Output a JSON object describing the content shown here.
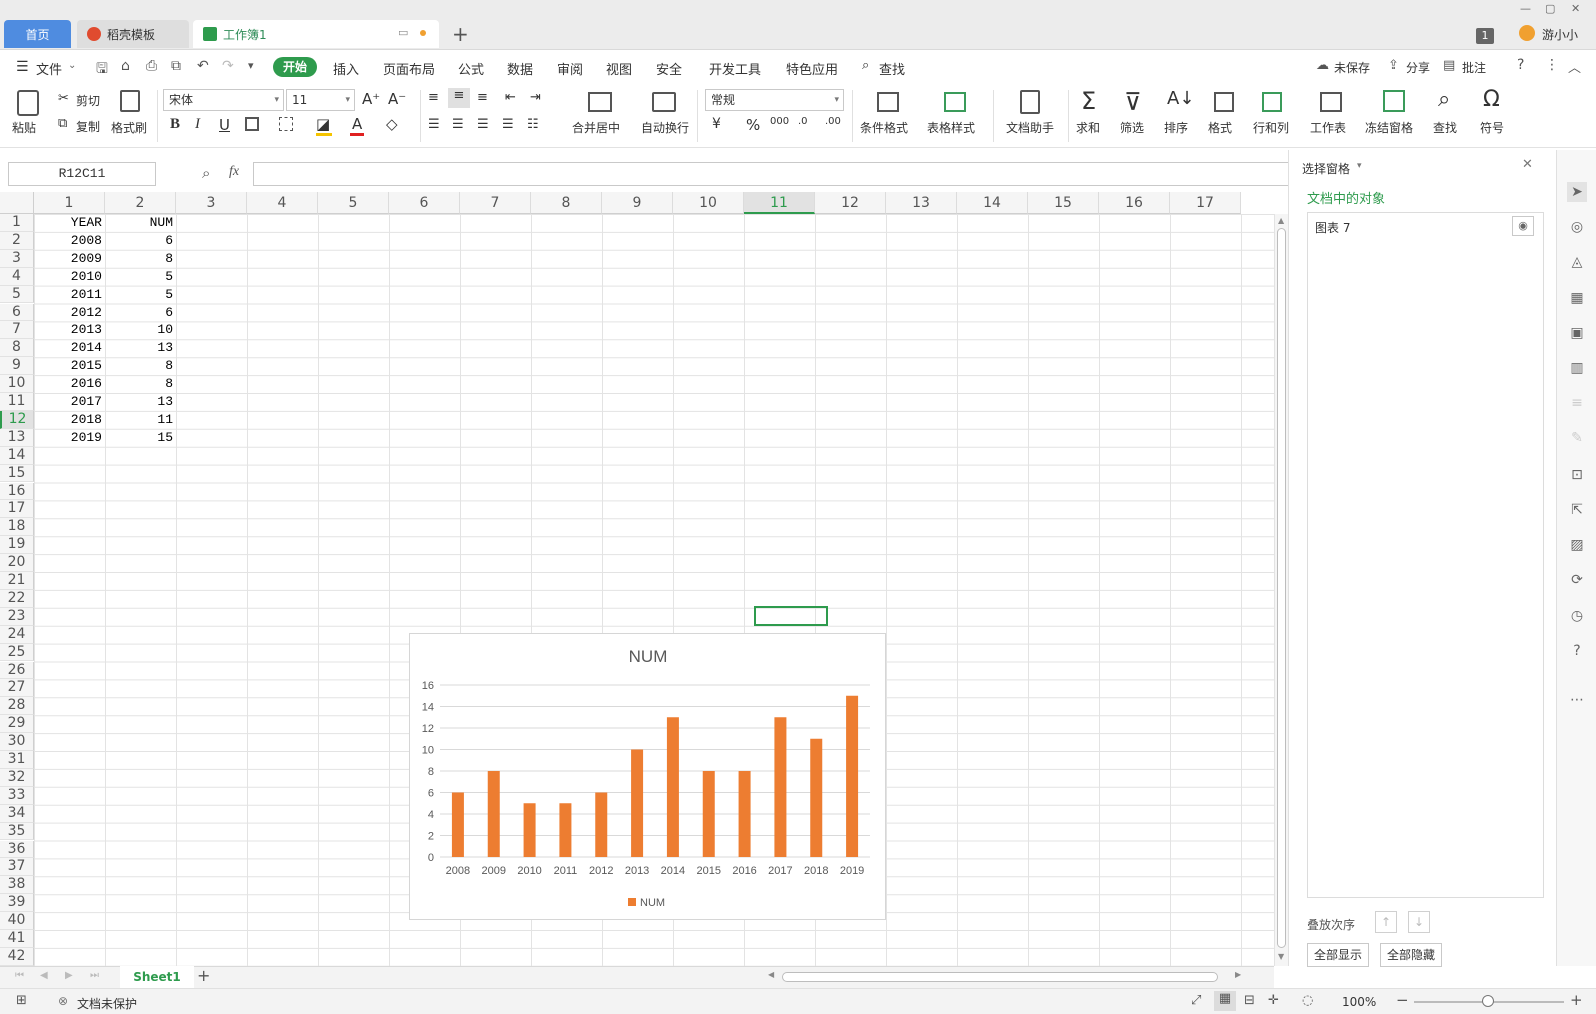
{
  "tabs": {
    "home": "首页",
    "template": "稻壳模板",
    "workbook": "工作簿1",
    "user": "游小小",
    "badge": "1"
  },
  "menu": {
    "file": "文件",
    "start": "开始",
    "items": [
      "插入",
      "页面布局",
      "公式",
      "数据",
      "审阅",
      "视图",
      "安全",
      "开发工具",
      "特色应用"
    ],
    "search": "查找",
    "unsaved": "未保存",
    "share": "分享",
    "comment": "批注"
  },
  "ribbon": {
    "paste": "粘贴",
    "cut": "剪切",
    "copy": "复制",
    "format_painter": "格式刷",
    "font": "宋体",
    "font_size": "11",
    "merge": "合并居中",
    "wrap": "自动换行",
    "number_format": "常规",
    "cond_format": "条件格式",
    "table_style": "表格样式",
    "doc_helper": "文档助手",
    "sum": "求和",
    "filter": "筛选",
    "sort": "排序",
    "format": "格式",
    "rowcol": "行和列",
    "worksheet": "工作表",
    "freeze": "冻结窗格",
    "find": "查找",
    "symbol": "符号"
  },
  "formula_bar": {
    "name_box": "R12C11",
    "fx": "fx",
    "formula": ""
  },
  "grid": {
    "columns": [
      "1",
      "2",
      "3",
      "4",
      "5",
      "6",
      "7",
      "8",
      "9",
      "10",
      "11",
      "12",
      "13",
      "14",
      "15",
      "16",
      "17"
    ],
    "selected_col": "11",
    "selected_row": "12",
    "rows": [
      "1",
      "2",
      "3",
      "4",
      "5",
      "6",
      "7",
      "8",
      "9",
      "10",
      "11",
      "12",
      "13",
      "14",
      "15",
      "16",
      "17",
      "18",
      "19",
      "20",
      "21",
      "22",
      "23",
      "24",
      "25",
      "26",
      "27",
      "28",
      "29",
      "30",
      "31",
      "32",
      "33",
      "34",
      "35",
      "36",
      "37",
      "38",
      "39",
      "40",
      "41",
      "42"
    ],
    "data": [
      [
        "YEAR",
        "NUM"
      ],
      [
        "2008",
        "6"
      ],
      [
        "2009",
        "8"
      ],
      [
        "2010",
        "5"
      ],
      [
        "2011",
        "5"
      ],
      [
        "2012",
        "6"
      ],
      [
        "2013",
        "10"
      ],
      [
        "2014",
        "13"
      ],
      [
        "2015",
        "8"
      ],
      [
        "2016",
        "8"
      ],
      [
        "2017",
        "13"
      ],
      [
        "2018",
        "11"
      ],
      [
        "2019",
        "15"
      ]
    ]
  },
  "chart_data": {
    "type": "bar",
    "title": "NUM",
    "categories": [
      "2008",
      "2009",
      "2010",
      "2011",
      "2012",
      "2013",
      "2014",
      "2015",
      "2016",
      "2017",
      "2018",
      "2019"
    ],
    "series": [
      {
        "name": "NUM",
        "values": [
          6,
          8,
          5,
          5,
          6,
          10,
          13,
          8,
          8,
          13,
          11,
          15
        ],
        "color": "#ed7d31"
      }
    ],
    "ylim": [
      0,
      16
    ],
    "yticks": [
      "0",
      "2",
      "4",
      "6",
      "8",
      "10",
      "12",
      "14",
      "16"
    ],
    "legend": "bottom",
    "grid": true
  },
  "pane": {
    "title": "选择窗格",
    "objects_header": "文档中的对象",
    "object_item": "图表 7",
    "order_label": "叠放次序",
    "show_all": "全部显示",
    "hide_all": "全部隐藏"
  },
  "sheetbar": {
    "sheet": "Sheet1"
  },
  "status": {
    "protect": "文档未保护",
    "zoom": "100%"
  },
  "colors": {
    "accent_green": "#2e9b4d",
    "tab_blue": "#4f8ce0",
    "bar_orange": "#ed7d31"
  }
}
